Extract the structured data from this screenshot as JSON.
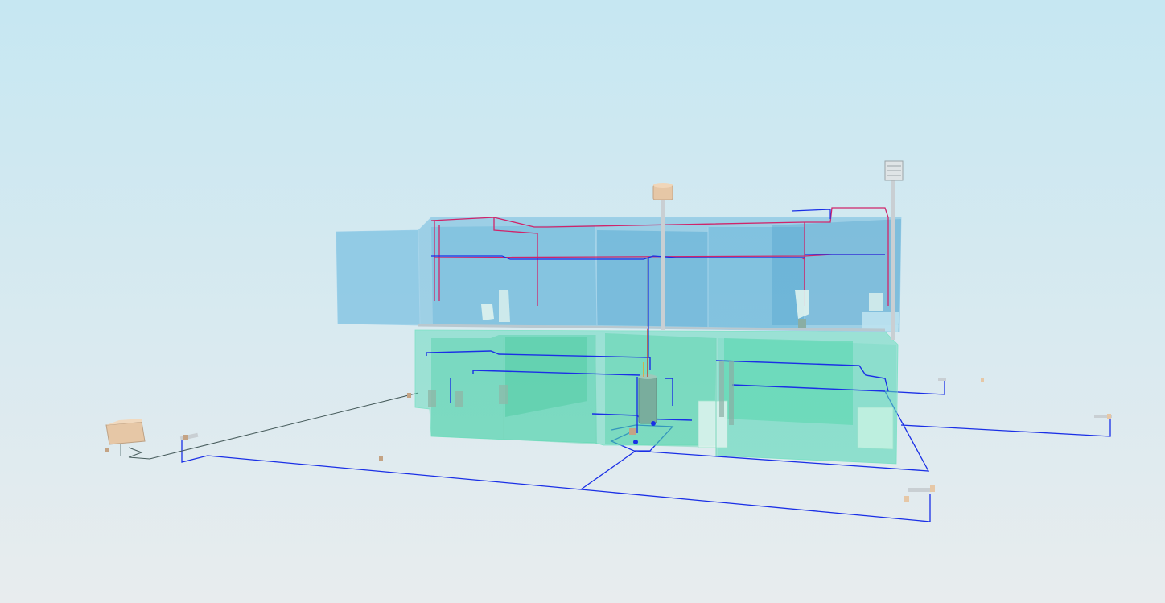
{
  "viewer": {
    "background_top": "#c6e7f2",
    "background_bottom": "#e8ecee"
  },
  "colors": {
    "upper_floor_fill": "#6fb9dd",
    "ground_floor_fill": "#4fd8b4",
    "cold_water_pipe": "#1a2fe6",
    "hot_water_pipe": "#d0246a",
    "supply_line": "#455a5a",
    "equipment_tan": "#e6c7a6",
    "fixture_white": "#dff3ee",
    "vent_grey": "#c9cfd3"
  },
  "objects": [
    {
      "id": "upper-floor-block",
      "icon": "building-volume-icon"
    },
    {
      "id": "ground-floor-block",
      "icon": "building-volume-icon"
    },
    {
      "id": "water-heater",
      "icon": "water-heater-icon"
    },
    {
      "id": "roof-tank",
      "icon": "tank-icon"
    },
    {
      "id": "roof-vent",
      "icon": "vent-icon"
    },
    {
      "id": "outdoor-tank",
      "icon": "tank-icon"
    }
  ]
}
